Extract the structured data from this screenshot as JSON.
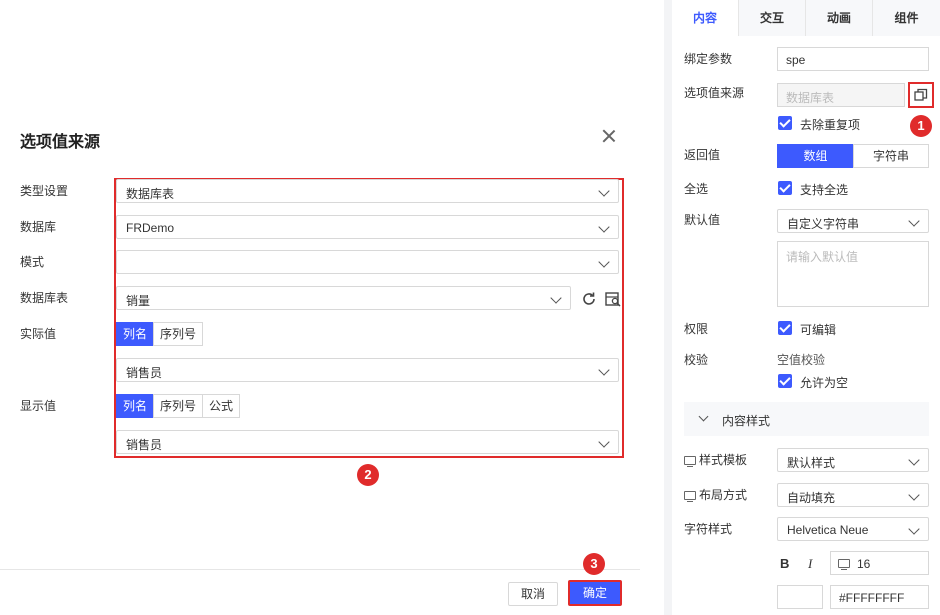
{
  "dialog": {
    "title": "选项值来源",
    "labels": {
      "type": "类型设置",
      "database": "数据库",
      "schema": "模式",
      "table": "数据库表",
      "actual": "实际值",
      "display": "显示值"
    },
    "type_value": "数据库表",
    "database_value": "FRDemo",
    "schema_value": "",
    "table_value": "销量",
    "actual_options": [
      "列名",
      "序列号"
    ],
    "actual_selected": "列名",
    "actual_value": "销售员",
    "display_options": [
      "列名",
      "序列号",
      "公式"
    ],
    "display_selected": "列名",
    "display_value": "销售员",
    "cancel_label": "取消",
    "ok_label": "确定"
  },
  "badges": [
    "1",
    "2",
    "3"
  ],
  "panel": {
    "tabs": [
      "内容",
      "交互",
      "动画",
      "组件"
    ],
    "active_tab": "内容",
    "bind_param_label": "绑定参数",
    "bind_param_value": "spe",
    "source_label": "选项值来源",
    "source_value": "数据库表",
    "dedupe_label": "去除重复项",
    "return_label": "返回值",
    "return_options": [
      "数组",
      "字符串"
    ],
    "return_selected": "数组",
    "select_all_label": "全选",
    "select_all_check": "支持全选",
    "default_label": "默认值",
    "default_value": "自定义字符串",
    "default_placeholder": "请输入默认值",
    "permission_label": "权限",
    "permission_check": "可编辑",
    "validate_label": "校验",
    "validate_sub": "空值校验",
    "allow_empty": "允许为空",
    "section_title": "内容样式",
    "style_template_label": "样式模板",
    "style_template_value": "默认样式",
    "layout_label": "布局方式",
    "layout_value": "自动填充",
    "font_label": "字符样式",
    "font_value": "Helvetica Neue",
    "bold": "B",
    "italic": "I",
    "font_size": "16",
    "color_value": "#FFFFFFFF"
  },
  "colors": {
    "accent": "#3d5afe",
    "highlight_red": "#e02b2b"
  }
}
